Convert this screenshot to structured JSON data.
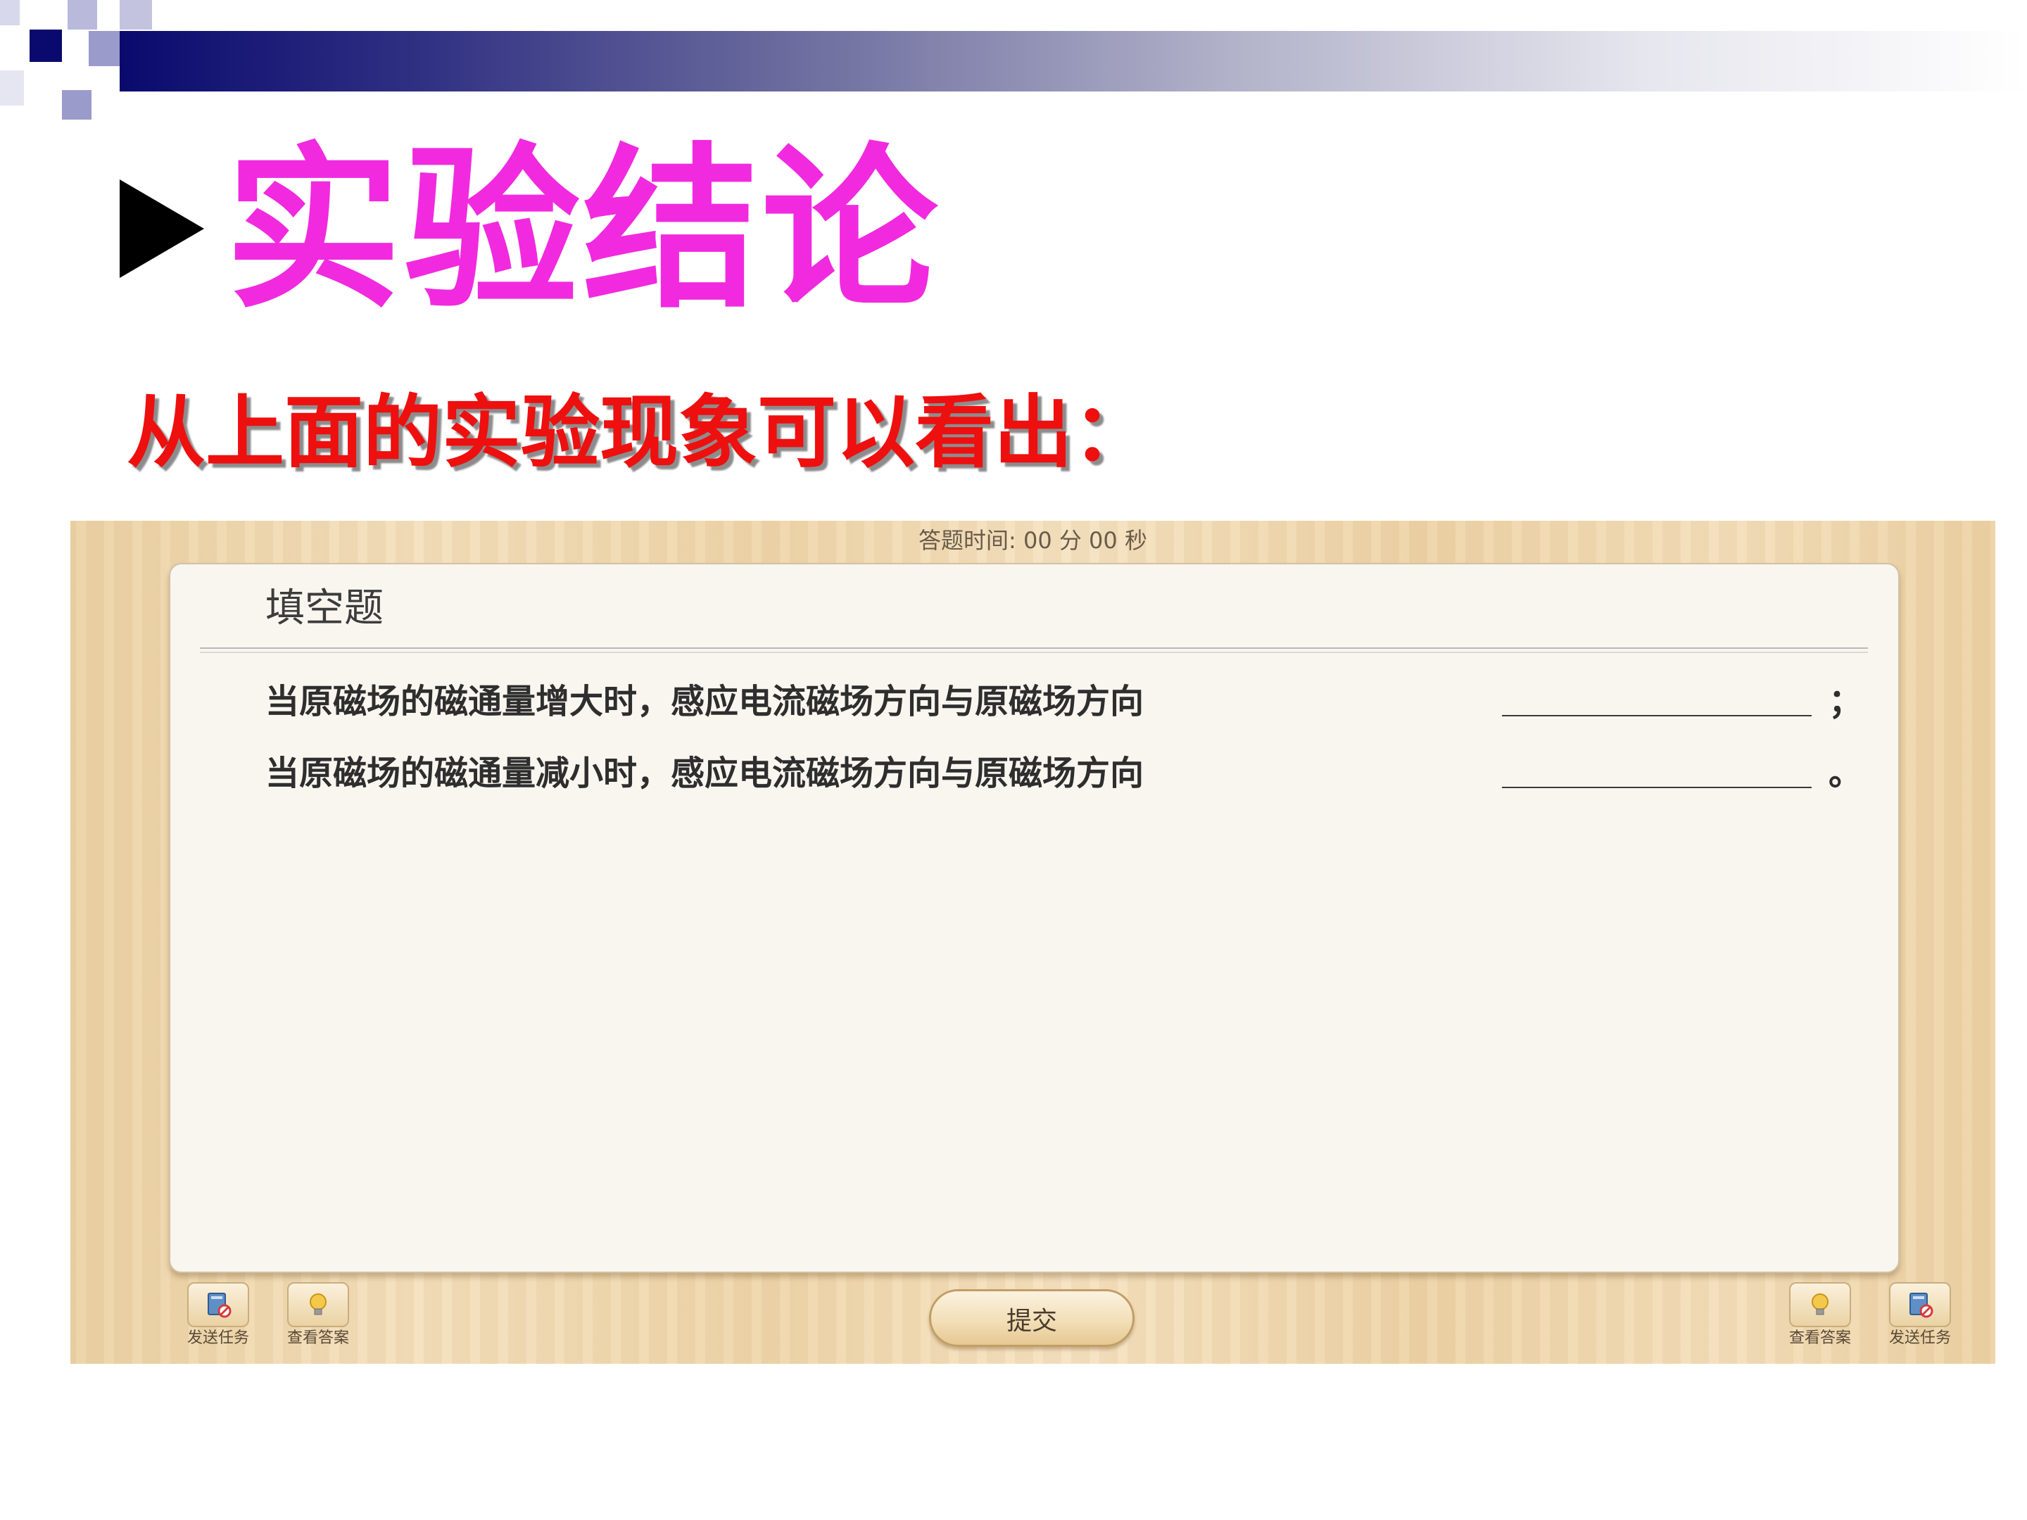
{
  "slide": {
    "title": "实验结论",
    "subtitle": "从上面的实验现象可以看出："
  },
  "quiz": {
    "timer": "答题时间:  00 分 00 秒",
    "type_label": "填空题",
    "questions": [
      {
        "text": "当原磁场的磁通量增大时，感应电流磁场方向与原磁场方向",
        "end": "；"
      },
      {
        "text": "当原磁场的磁通量减小时，感应电流磁场方向与原磁场方向",
        "end": "。"
      }
    ],
    "toolbar": {
      "left": [
        {
          "label": "发送任务",
          "icon": "send-task-icon"
        },
        {
          "label": "查看答案",
          "icon": "lightbulb-icon"
        }
      ],
      "right": [
        {
          "label": "查看答案",
          "icon": "lightbulb-icon"
        },
        {
          "label": "发送任务",
          "icon": "send-task-icon"
        }
      ],
      "submit_label": "提交"
    }
  },
  "colors": {
    "title": "#f12adf",
    "subtitle": "#ee0f0f",
    "header_dark": "#0a0a6e",
    "wood": "#f4e0bd"
  }
}
